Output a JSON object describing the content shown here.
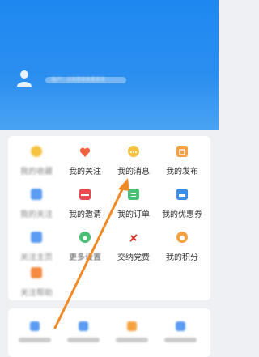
{
  "status_bar": {
    "left": "",
    "right": ""
  },
  "profile": {
    "name_text": "账户：点击登录查看更多"
  },
  "grid": {
    "rows": [
      [
        {
          "label": "我的收藏",
          "color": "#f5c242",
          "blurred": true
        },
        {
          "label": "我的关注",
          "color": "#f2623f",
          "blurred": false
        },
        {
          "label": "我的消息",
          "color": "#f5c242",
          "blurred": false
        },
        {
          "label": "我的发布",
          "color": "#f5a142",
          "blurred": false
        }
      ],
      [
        {
          "label": "我的关注",
          "color": "#5b9cf2",
          "blurred": true
        },
        {
          "label": "我的邀请",
          "color": "#e84a50",
          "blurred": false
        },
        {
          "label": "我的订单",
          "color": "#4bbf73",
          "blurred": false
        },
        {
          "label": "我的优惠券",
          "color": "#3a8ee6",
          "blurred": false
        }
      ],
      [
        {
          "label": "关注主页",
          "color": "#5b9cf2",
          "blurred": true
        },
        {
          "label": "更多设置",
          "color": "#4bbf73",
          "blurred": false,
          "soft": true
        },
        {
          "label": "交纳党费",
          "color": "#d9342b",
          "blurred": false
        },
        {
          "label": "我的积分",
          "color": "#f5a142",
          "blurred": false
        }
      ],
      [
        {
          "label": "关注帮助",
          "color": "#f58b42",
          "blurred": true
        }
      ]
    ]
  },
  "bottom_card": {
    "items": [
      "",
      "",
      "",
      ""
    ]
  },
  "colors": {
    "header": "#1e88f0",
    "arrow": "#f08a24"
  }
}
